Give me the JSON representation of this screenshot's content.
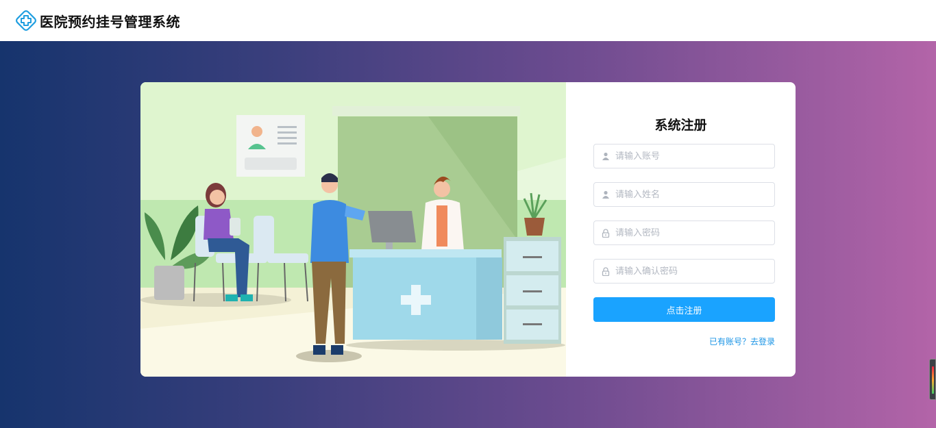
{
  "header": {
    "app_title": "医院预约挂号管理系统",
    "logo_icon": "medical-cross-icon"
  },
  "register": {
    "title": "系统注册",
    "fields": [
      {
        "icon": "user-icon",
        "placeholder": "请输入账号"
      },
      {
        "icon": "user-icon",
        "placeholder": "请输入姓名"
      },
      {
        "icon": "lock-icon",
        "placeholder": "请输入密码"
      },
      {
        "icon": "lock-icon",
        "placeholder": "请输入确认密码"
      }
    ],
    "submit_label": "点击注册",
    "login_link": "已有账号？去登录"
  },
  "colors": {
    "accent": "#1aa3ff",
    "gradient_start": "#16346d",
    "gradient_end": "#b364a8",
    "link": "#1a94e6"
  }
}
